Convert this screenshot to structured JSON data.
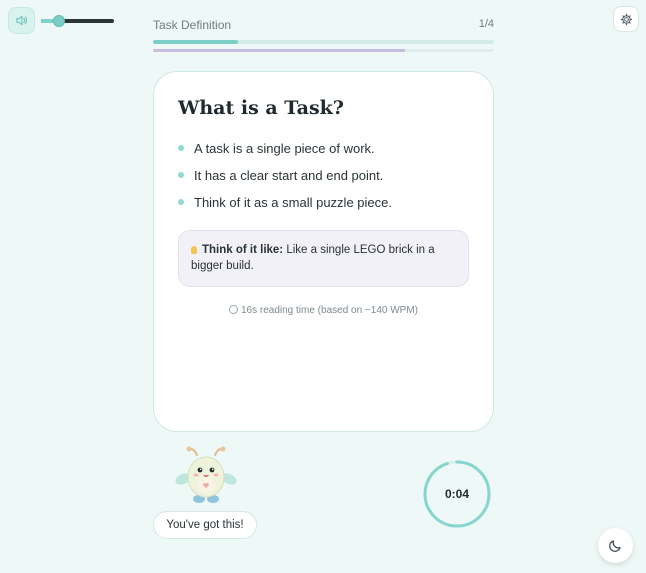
{
  "audio": {
    "speaker_icon": "speaker-icon",
    "volume": 0.25
  },
  "header": {
    "section_title": "Task Definition",
    "step_counter": "1/4",
    "progress": 0.25,
    "sub_progress": 0.74
  },
  "settings": {
    "icon": "gear-icon"
  },
  "card": {
    "title": "What is a Task?",
    "bullets": [
      "A task is a single piece of work.",
      "It has a clear start and end point.",
      "Think of it as a small puzzle piece."
    ],
    "tip": {
      "icon": "lightbulb-icon",
      "label": "Think of it like:",
      "text": "Like a single LEGO brick in a bigger build."
    },
    "reading_time": "16s reading time (based on ~140 WPM)"
  },
  "mascot": {
    "encouragement": "You've got this!"
  },
  "timer": {
    "value": "0:04",
    "fraction": 0.95
  },
  "theme_toggle": {
    "icon": "moon-icon"
  },
  "colors": {
    "accent": "#7ccfc7",
    "background": "#eef8f6",
    "sub_progress": "#c6bde0"
  }
}
